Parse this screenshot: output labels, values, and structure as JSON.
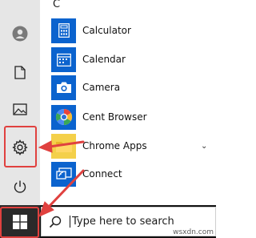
{
  "colors": {
    "tile_blue": "#0b63ce",
    "accent_red": "#e0413f",
    "rail_bg": "#e6e6e6",
    "taskbar_bg": "#101010"
  },
  "start_menu": {
    "section_letter": "C",
    "apps": [
      {
        "name": "Calculator",
        "icon": "calculator-icon"
      },
      {
        "name": "Calendar",
        "icon": "calendar-icon"
      },
      {
        "name": "Camera",
        "icon": "camera-icon"
      },
      {
        "name": "Cent Browser",
        "icon": "cent-browser-icon"
      },
      {
        "name": "Chrome Apps",
        "icon": "folder-icon"
      },
      {
        "name": "Connect",
        "icon": "connect-icon"
      }
    ]
  },
  "rail": {
    "items": [
      "avatar-icon",
      "document-icon",
      "pictures-icon",
      "settings-icon",
      "power-icon"
    ]
  },
  "taskbar": {
    "search_placeholder": "Type here to search",
    "start_icon": "windows-logo-icon"
  },
  "watermark": "wsxdn.com"
}
